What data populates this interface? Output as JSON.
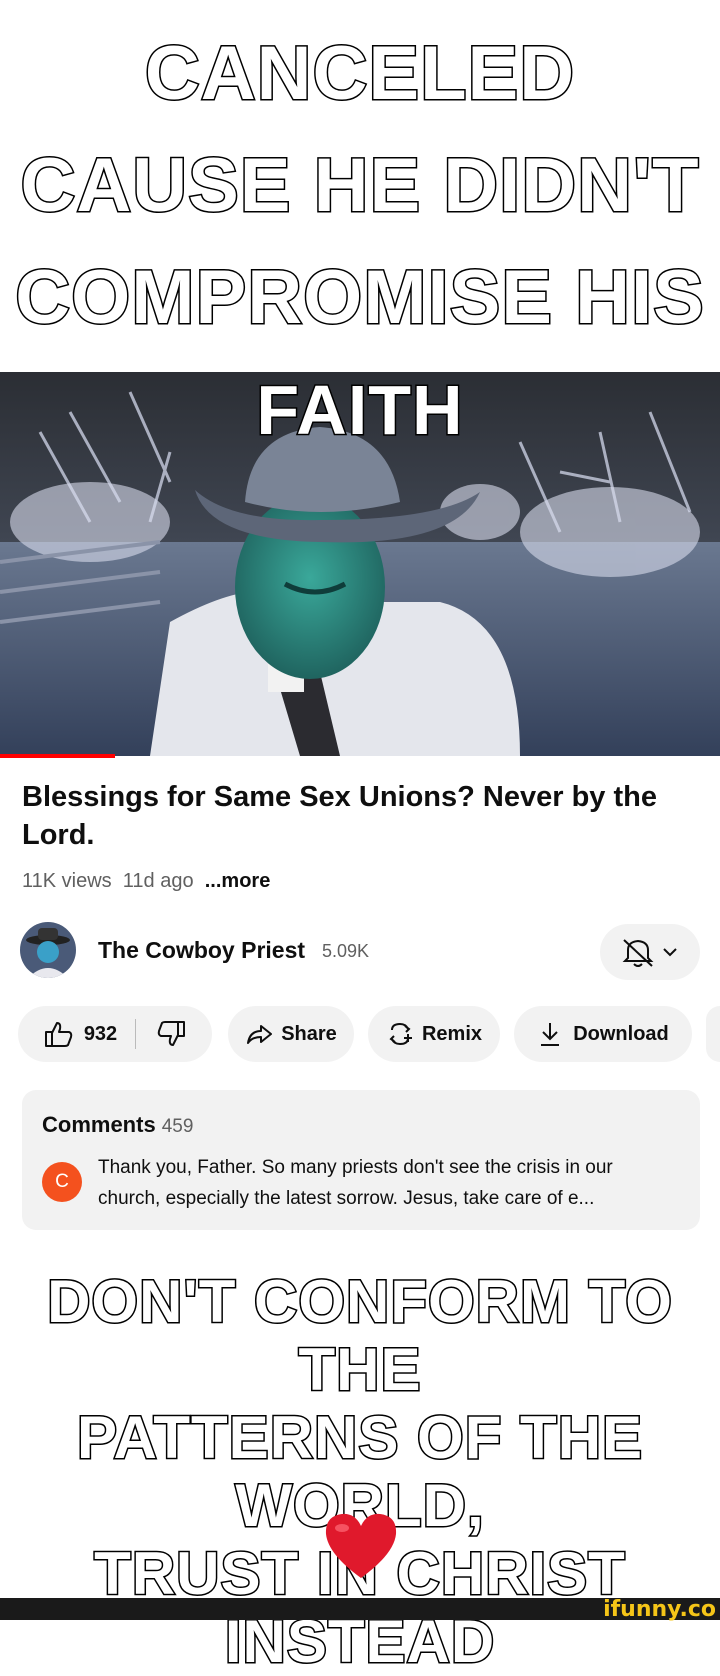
{
  "top_caption": "CANCELED CAUSE HE DIDN'T COMPROMISE HIS",
  "top_caption_last": "FAITH",
  "video": {
    "title": "Blessings for Same Sex Unions? Never by the Lord.",
    "views": "11K views",
    "age": "11d ago",
    "more_label": "...more",
    "progress_fraction": 0.16
  },
  "channel": {
    "name": "The Cowboy Priest",
    "subscribers": "5.09K",
    "bell_icon": "bell-off-icon",
    "chevron_icon": "chevron-down-icon"
  },
  "actions": {
    "likes": "932",
    "share_label": "Share",
    "remix_label": "Remix",
    "download_label": "Download"
  },
  "comments": {
    "label": "Comments",
    "count": "459",
    "first_avatar_letter": "C",
    "first_text": "Thank you, Father. So many priests don't see the crisis in our church, especially the latest sorrow. Jesus, take care of e..."
  },
  "bottom_caption": {
    "line1": "DON'T CONFORM TO THE",
    "line2": "PATTERNS OF THE WORLD,",
    "line3": "TRUST IN CHRIST INSTEAD"
  },
  "watermark": "ifunny.co",
  "colors": {
    "accent_red": "#ff0000",
    "pill_bg": "#f2f2f2",
    "comment_avatar": "#f4511e",
    "heart": "#e0192c"
  }
}
